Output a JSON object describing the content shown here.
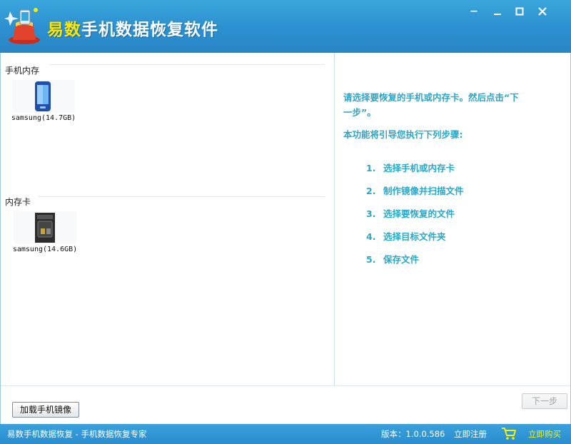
{
  "window": {
    "title_brand": "易数",
    "title_rest": "手机数据恢复软件",
    "minimize": "−",
    "restore": "□",
    "close": "×"
  },
  "sections": {
    "phone_memory": "手机内存",
    "memory_card": "内存卡"
  },
  "devices": {
    "phone": "samsung(14.7GB)",
    "card": "samsung(14.6GB)"
  },
  "guide": {
    "line1": "请选择要恢复的手机或内存卡。然后点击“下",
    "line2": "一步”。",
    "intro": "本功能将引导您执行下列步骤:",
    "steps": [
      {
        "num": "1.",
        "text": "选择手机或内存卡"
      },
      {
        "num": "2.",
        "text": "制作镜像并扫描文件"
      },
      {
        "num": "3.",
        "text": "选择要恢复的文件"
      },
      {
        "num": "4.",
        "text": "选择目标文件夹"
      },
      {
        "num": "5.",
        "text": "保存文件"
      }
    ]
  },
  "buttons": {
    "load_image": "加载手机镜像",
    "next": "下一步"
  },
  "status": {
    "left": "易数手机数据恢复 - 手机数据恢复专家",
    "version": "版本：1.0.0.586",
    "register": "立即注册",
    "buy": "立即购买"
  },
  "colors": {
    "titlebar": "#2b8fcf",
    "guide_text": "#2aa7c9",
    "buy_text": "#f7f200",
    "brand_text": "#ffe600"
  },
  "icons": {
    "logo": "magic-hat-icon",
    "phone": "mobile-phone-icon",
    "card": "memory-card-icon",
    "cart": "shopping-cart-icon"
  }
}
